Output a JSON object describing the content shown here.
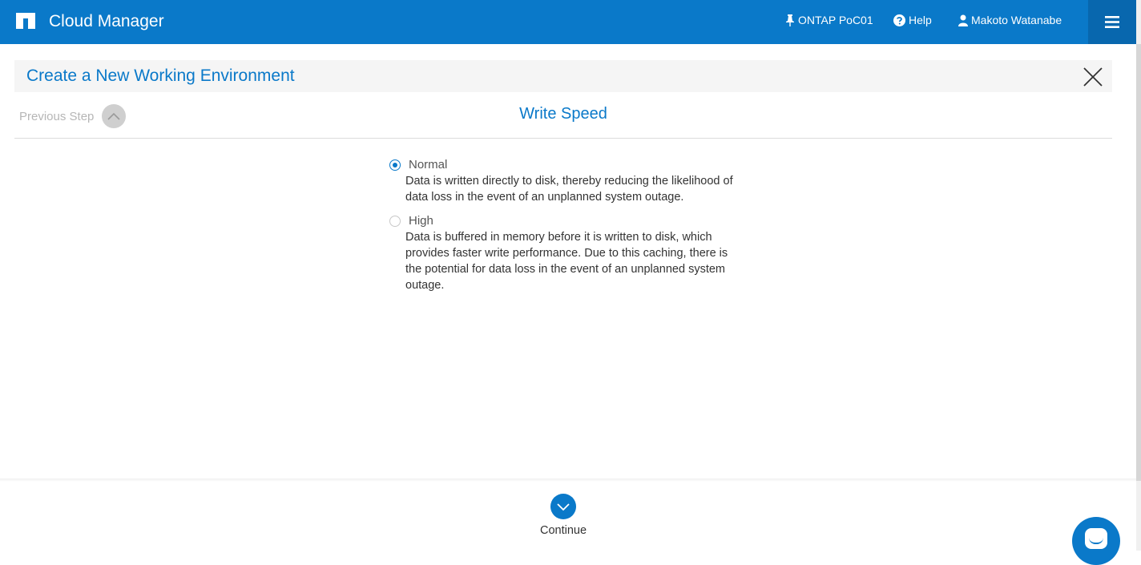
{
  "app": {
    "title": "Cloud Manager",
    "logo_icon": "netapp-logo-icon"
  },
  "topbar": {
    "environment": {
      "label": "ONTAP PoC01",
      "icon": "pin-icon"
    },
    "help": {
      "label": "Help",
      "icon": "question-circle-icon"
    },
    "user": {
      "label": "Makoto Watanabe",
      "icon": "user-icon"
    },
    "menu_icon": "hamburger-menu-icon"
  },
  "page": {
    "title": "Create a New Working Environment",
    "close_icon": "close-icon",
    "previous_step_label": "Previous Step",
    "step_title": "Write Speed"
  },
  "options": [
    {
      "label": "Normal",
      "selected": true,
      "description": "Data is written directly to disk, thereby reducing the likelihood of data loss in the event of an unplanned system outage."
    },
    {
      "label": "High",
      "selected": false,
      "description": "Data is buffered in memory before it is written to disk, which provides faster write performance. Due to this caching, there is the potential for data loss in the event of an unplanned system outage."
    }
  ],
  "footer": {
    "continue_label": "Continue"
  },
  "colors": {
    "brand": "#0a79c9",
    "brand_dark": "#0867ae",
    "header_band": "#f5f5f5"
  }
}
